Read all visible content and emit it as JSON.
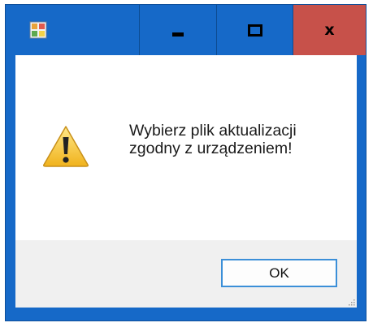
{
  "window": {
    "controls": {
      "minimize_icon": "minimize-icon",
      "maximize_icon": "maximize-icon",
      "close_glyph": "x"
    }
  },
  "dialog": {
    "icon": "warning-icon",
    "message_line1": "Wybierz plik aktualizacji",
    "message_line2": "zgodny z urządzeniem!",
    "ok_label": "OK"
  },
  "colors": {
    "titlebar": "#1669c8",
    "close_button": "#c7514a",
    "button_bar": "#f0f0f0",
    "ok_border": "#3b8fd8"
  }
}
